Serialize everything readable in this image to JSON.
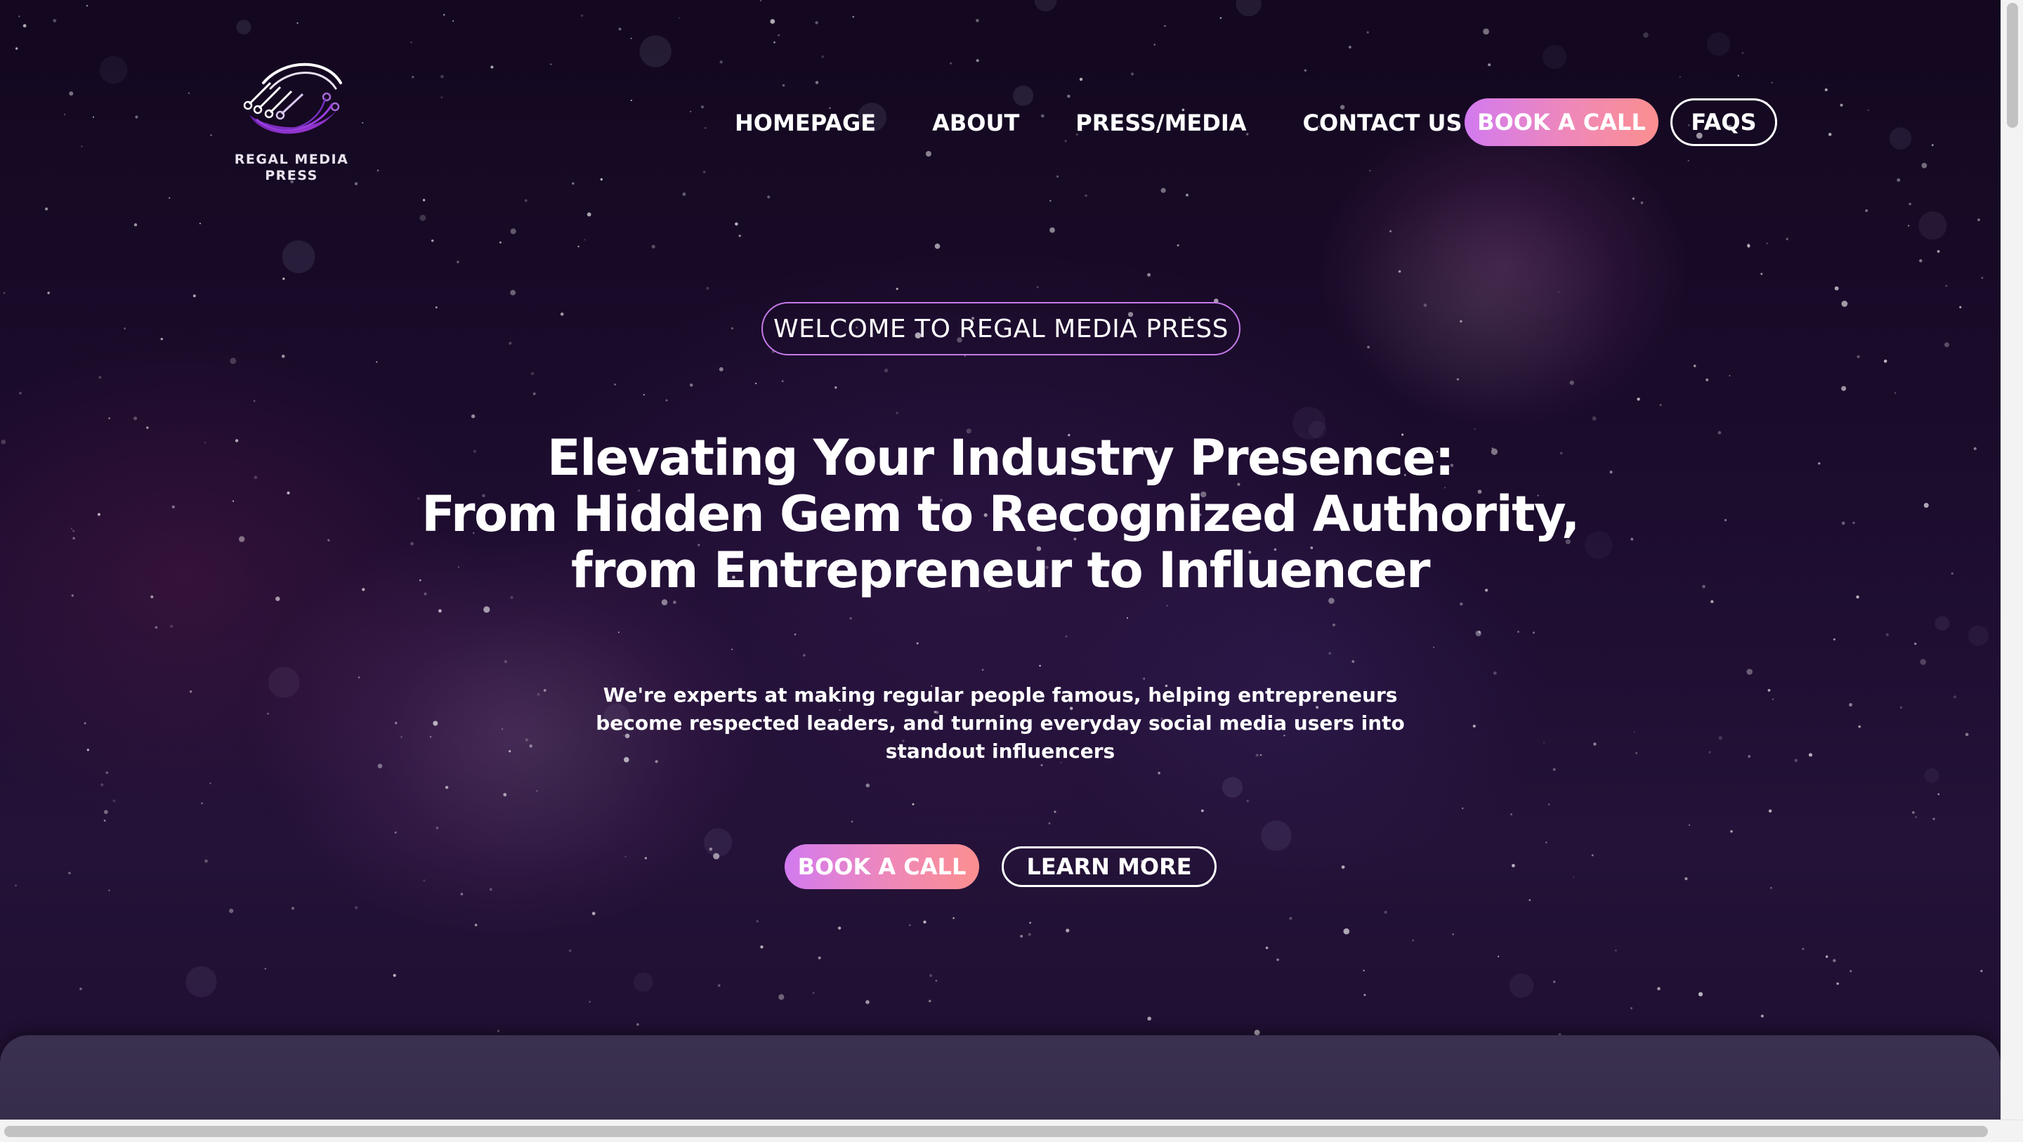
{
  "brand": {
    "name": "REGAL MEDIA\nPRESS",
    "logo_icon": "circuit-swoosh-logo",
    "logo_colors": [
      "#8a2be2",
      "#c98df0",
      "#ffffff"
    ]
  },
  "nav": {
    "links": [
      {
        "label": "HOMEPAGE"
      },
      {
        "label": "ABOUT"
      },
      {
        "label": "PRESS/MEDIA"
      },
      {
        "label": "CONTACT US"
      }
    ],
    "book_label": "BOOK A CALL",
    "faqs_label": "FAQS"
  },
  "hero": {
    "welcome": "WELCOME TO REGAL MEDIA PRESS",
    "headline_lines": [
      "Elevating Your Industry Presence:",
      "From Hidden Gem to Recognized Authority,",
      "from Entrepreneur to Influencer"
    ],
    "subtext_lines": [
      "We're experts at making regular people famous, helping entrepreneurs",
      "become respected leaders, and turning everyday social media users into",
      "standout influencers"
    ],
    "book_label": "BOOK A CALL",
    "learn_label": "LEARN MORE"
  },
  "colors": {
    "background": "#1c0c2e",
    "accent_gradient_start": "#d27af0",
    "accent_gradient_end": "#fb8f8f",
    "pill_border": "#c47ae8",
    "text": "#ffffff"
  }
}
